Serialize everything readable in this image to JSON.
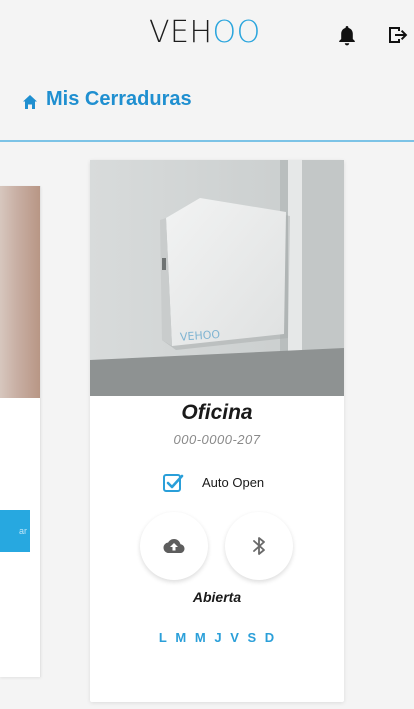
{
  "header": {
    "brand_prefix": "VEH",
    "brand_highlight": "OO",
    "brand_color": "#2aa5dd",
    "icons": [
      "bell-icon",
      "logout-icon"
    ]
  },
  "section": {
    "title": "Mis Cerraduras",
    "icon": "home-icon",
    "accent": "#1f8fd0"
  },
  "left_card": {
    "button_label": "ar"
  },
  "lock": {
    "name": "Oficina",
    "code": "000-0000-207",
    "auto_open_label": "Auto Open",
    "auto_open_checked": true,
    "device_brand": "VEHOO",
    "actions": [
      "cloud-upload-icon",
      "bluetooth-icon"
    ],
    "status": "Abierta",
    "days": [
      "L",
      "M",
      "M",
      "J",
      "V",
      "S",
      "D"
    ],
    "days_color": "#2a9fd9"
  }
}
